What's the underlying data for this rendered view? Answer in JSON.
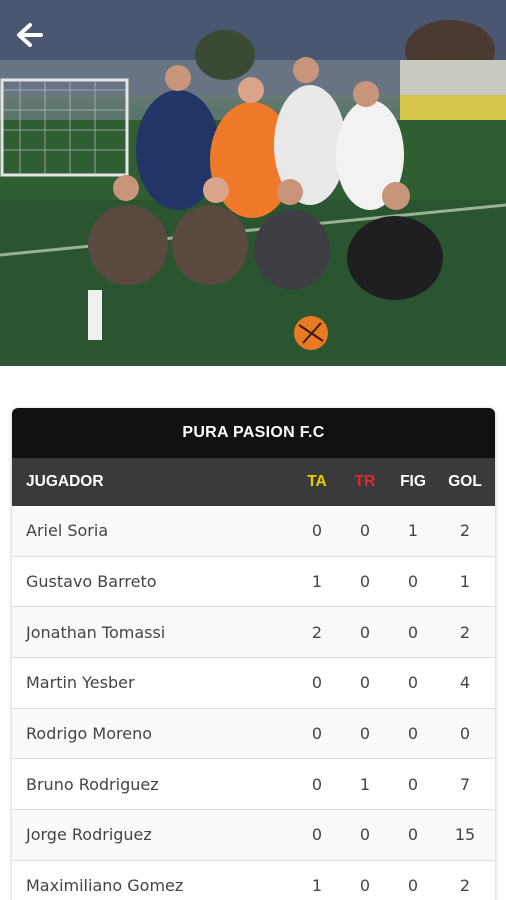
{
  "header": {
    "back_icon": "arrow-left-icon",
    "photo_alt": "Foto del equipo"
  },
  "table": {
    "team_name": "PURA PASION F.C",
    "columns": {
      "player": "JUGADOR",
      "ta": "TA",
      "tr": "TR",
      "fig": "FIG",
      "gol": "GOL"
    },
    "column_colors": {
      "ta": "#e8d000",
      "tr": "#e02a2a"
    },
    "rows": [
      {
        "name": "Ariel Soria",
        "ta": "0",
        "tr": "0",
        "fig": "1",
        "gol": "2"
      },
      {
        "name": "Gustavo Barreto",
        "ta": "1",
        "tr": "0",
        "fig": "0",
        "gol": "1"
      },
      {
        "name": "Jonathan Tomassi",
        "ta": "2",
        "tr": "0",
        "fig": "0",
        "gol": "2"
      },
      {
        "name": "Martin Yesber",
        "ta": "0",
        "tr": "0",
        "fig": "0",
        "gol": "4"
      },
      {
        "name": "Rodrigo Moreno",
        "ta": "0",
        "tr": "0",
        "fig": "0",
        "gol": "0"
      },
      {
        "name": "Bruno Rodriguez",
        "ta": "0",
        "tr": "1",
        "fig": "0",
        "gol": "7"
      },
      {
        "name": "Jorge Rodriguez",
        "ta": "0",
        "tr": "0",
        "fig": "0",
        "gol": "15"
      },
      {
        "name": "Maximiliano Gomez",
        "ta": "1",
        "tr": "0",
        "fig": "0",
        "gol": "2"
      }
    ]
  }
}
